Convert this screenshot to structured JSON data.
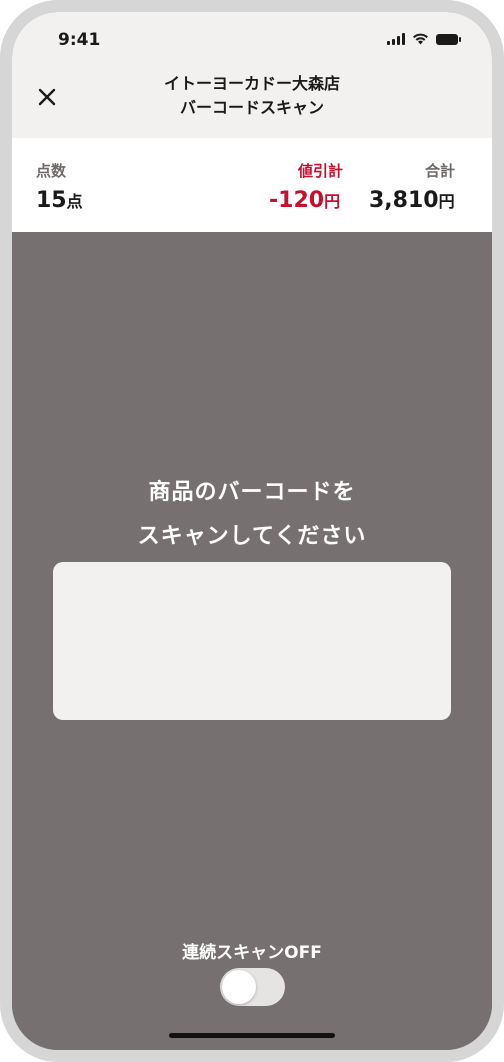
{
  "status_bar": {
    "time": "9:41"
  },
  "header": {
    "store_name": "イトーヨーカドー大森店",
    "screen_title": "バーコードスキャン",
    "close_icon": "close-icon"
  },
  "summary": {
    "count_label": "点数",
    "count_value": "15",
    "count_unit": "点",
    "discount_label": "値引計",
    "discount_value": "-120",
    "discount_unit": "円",
    "total_label": "合計",
    "total_value": "3,810",
    "total_unit": "円"
  },
  "scanner": {
    "instruction_line1": "商品のバーコードを",
    "instruction_line2": "スキャンしてください"
  },
  "continuous_scan": {
    "label": "連続スキャンOFF",
    "enabled": false
  },
  "colors": {
    "accent_red": "#c8102e",
    "scan_background": "#767170",
    "header_background": "#f2f1f0"
  }
}
